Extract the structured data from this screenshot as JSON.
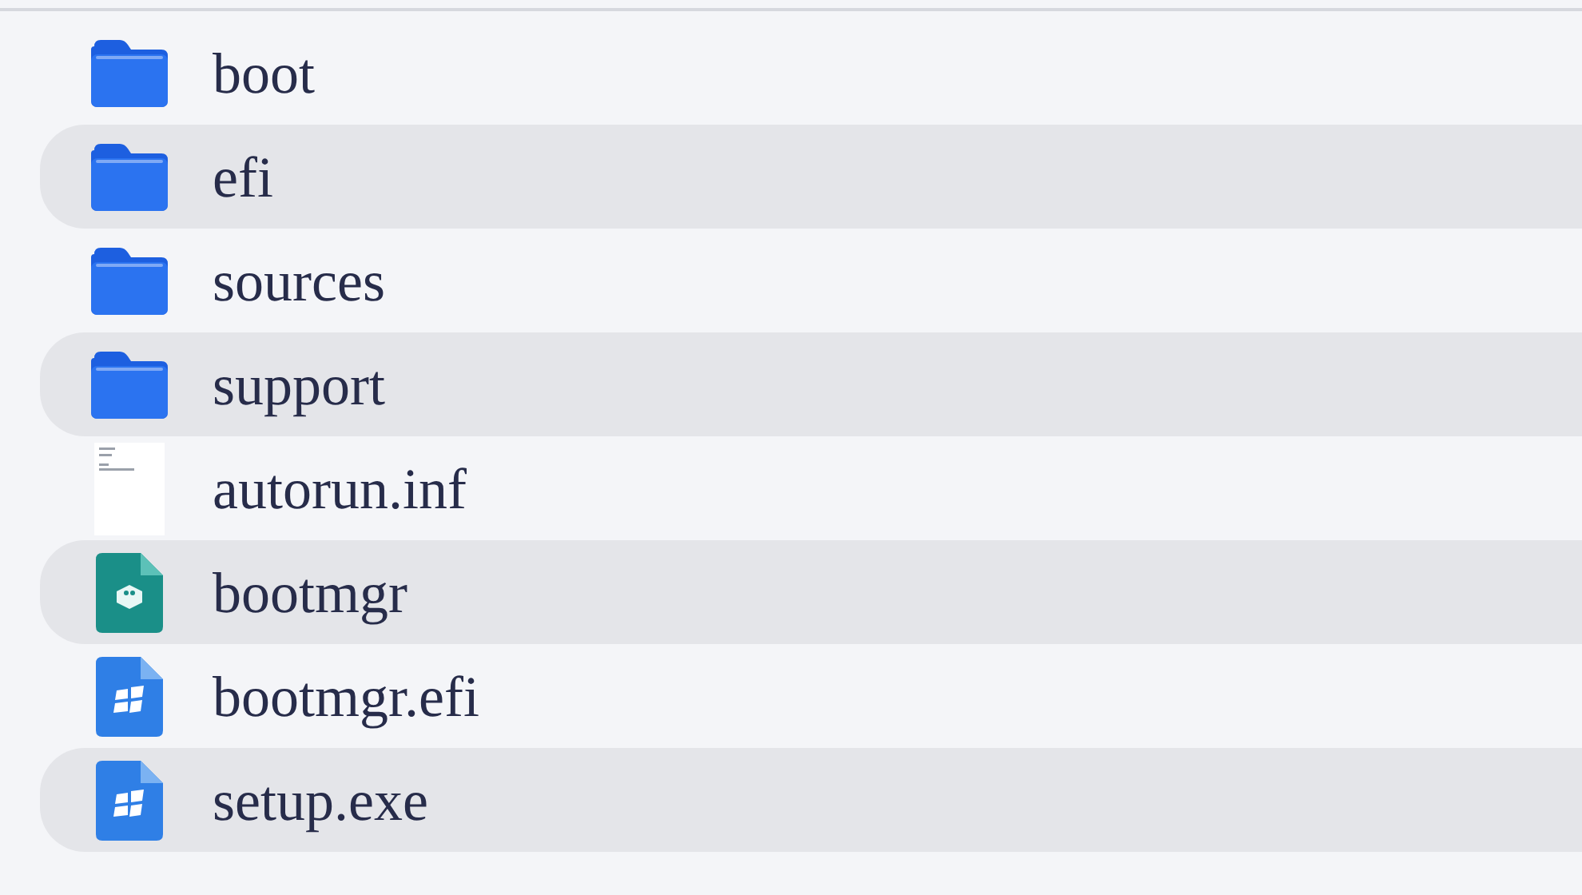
{
  "files": [
    {
      "name": "boot",
      "kind": "folder"
    },
    {
      "name": "efi",
      "kind": "folder"
    },
    {
      "name": "sources",
      "kind": "folder"
    },
    {
      "name": "support",
      "kind": "folder"
    },
    {
      "name": "autorun.inf",
      "kind": "document"
    },
    {
      "name": "bootmgr",
      "kind": "system"
    },
    {
      "name": "bootmgr.efi",
      "kind": "windows"
    },
    {
      "name": "setup.exe",
      "kind": "windows"
    }
  ]
}
